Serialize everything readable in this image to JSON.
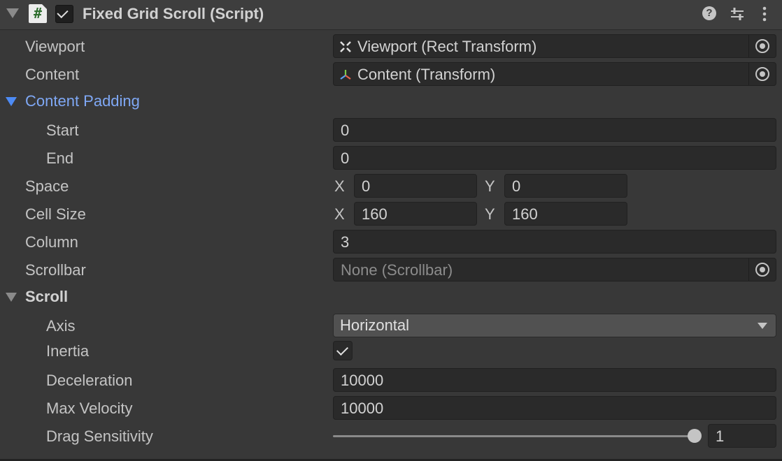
{
  "header": {
    "title": "Fixed Grid Scroll (Script)",
    "script_icon_glyph": "#",
    "enabled": true,
    "help_glyph": "?"
  },
  "fields": {
    "viewport": {
      "label": "Viewport",
      "value": "Viewport (Rect Transform)"
    },
    "content": {
      "label": "Content",
      "value": "Content (Transform)"
    },
    "content_padding": {
      "label": "Content Padding",
      "expanded": true,
      "start": {
        "label": "Start",
        "value": "0"
      },
      "end": {
        "label": "End",
        "value": "0"
      }
    },
    "space": {
      "label": "Space",
      "x_label": "X",
      "x": "0",
      "y_label": "Y",
      "y": "0"
    },
    "cell_size": {
      "label": "Cell Size",
      "x_label": "X",
      "x": "160",
      "y_label": "Y",
      "y": "160"
    },
    "column": {
      "label": "Column",
      "value": "3"
    },
    "scrollbar": {
      "label": "Scrollbar",
      "value": "None (Scrollbar)"
    },
    "scroll": {
      "label": "Scroll",
      "expanded": true,
      "axis": {
        "label": "Axis",
        "value": "Horizontal"
      },
      "inertia": {
        "label": "Inertia",
        "checked": true
      },
      "deceleration": {
        "label": "Deceleration",
        "value": "10000"
      },
      "max_velocity": {
        "label": "Max Velocity",
        "value": "10000"
      },
      "drag_sensitivity": {
        "label": "Drag Sensitivity",
        "value": "1",
        "slider_fraction": 1.0
      }
    }
  },
  "colors": {
    "background": "#383838",
    "header": "#3e3e3e",
    "field": "#2a2a2a",
    "foldout_blue": "#7fa8f5",
    "dropdown": "#515151"
  },
  "icons": {
    "collapse": "triangle-down-icon",
    "script": "csharp-script-icon",
    "help": "help-icon",
    "presets": "presets-sliders-icon",
    "menu": "kebab-menu-icon",
    "rect_transform": "rect-transform-icon",
    "transform": "transform-axes-icon",
    "object_picker": "object-picker-icon"
  }
}
